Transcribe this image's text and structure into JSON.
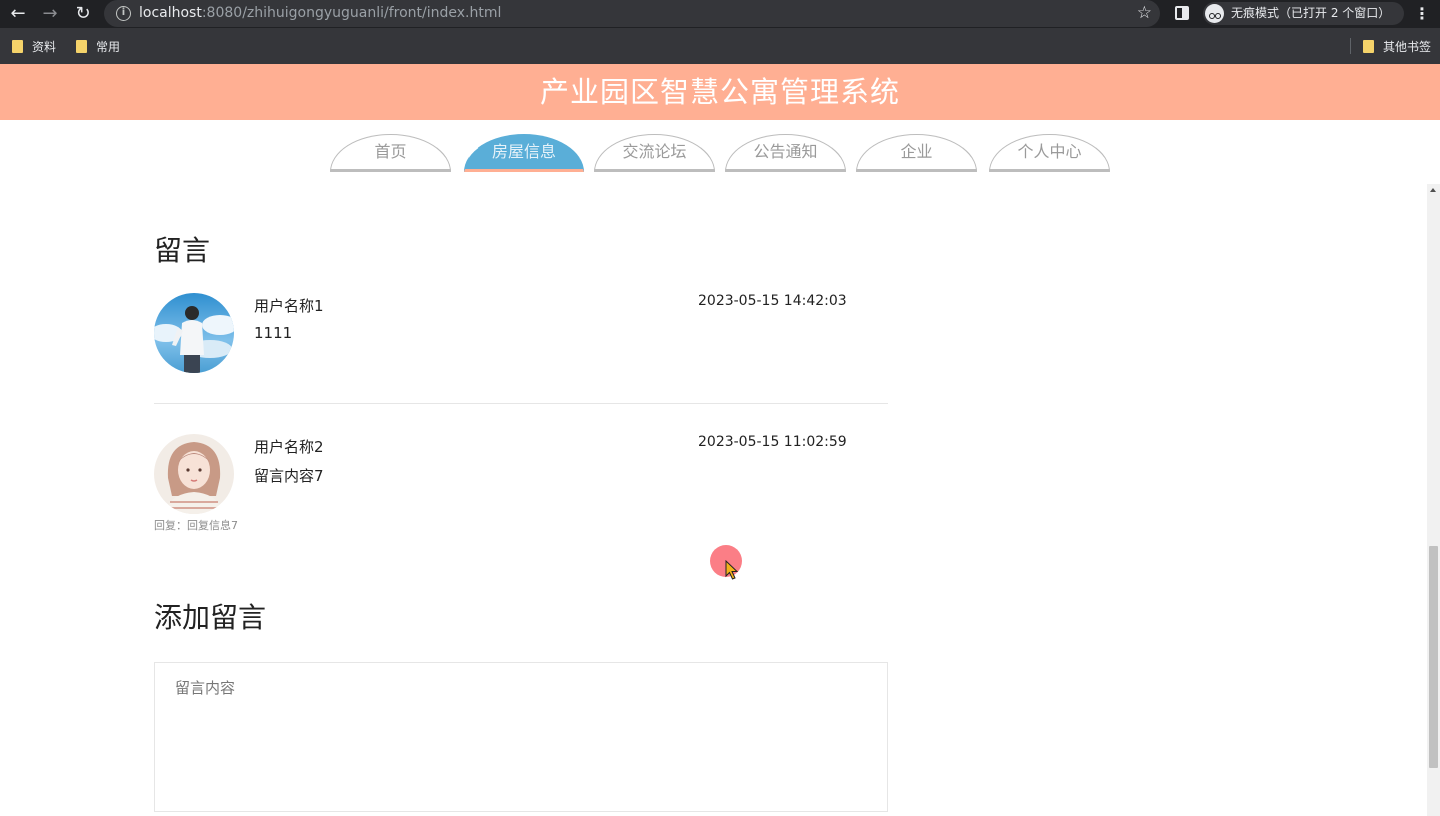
{
  "browser": {
    "url_host": "localhost",
    "url_rest": ":8080/zhihuigongyuguanli/front/index.html",
    "incognito_label": "无痕模式（已打开 2 个窗口）",
    "bookmarks": [
      "资料",
      "常用"
    ],
    "other_bookmarks": "其他书签"
  },
  "site": {
    "title": "产业园区智慧公寓管理系统",
    "accent_color": "#ffaf93",
    "active_tab_color": "#5aaed8"
  },
  "nav": {
    "tabs": [
      {
        "label": "首页",
        "active": false
      },
      {
        "label": "房屋信息",
        "active": true
      },
      {
        "label": "交流论坛",
        "active": false
      },
      {
        "label": "公告通知",
        "active": false
      },
      {
        "label": "企业",
        "active": false
      },
      {
        "label": "个人中心",
        "active": false
      }
    ]
  },
  "messages_section": {
    "heading": "留言",
    "items": [
      {
        "user": "用户名称1",
        "content": "1111",
        "time": "2023-05-15 14:42:03"
      },
      {
        "user": "用户名称2",
        "content": "留言内容7",
        "time": "2023-05-15 11:02:59",
        "reply": "回复：回复信息7"
      }
    ]
  },
  "add_section": {
    "heading": "添加留言",
    "placeholder": "留言内容"
  }
}
